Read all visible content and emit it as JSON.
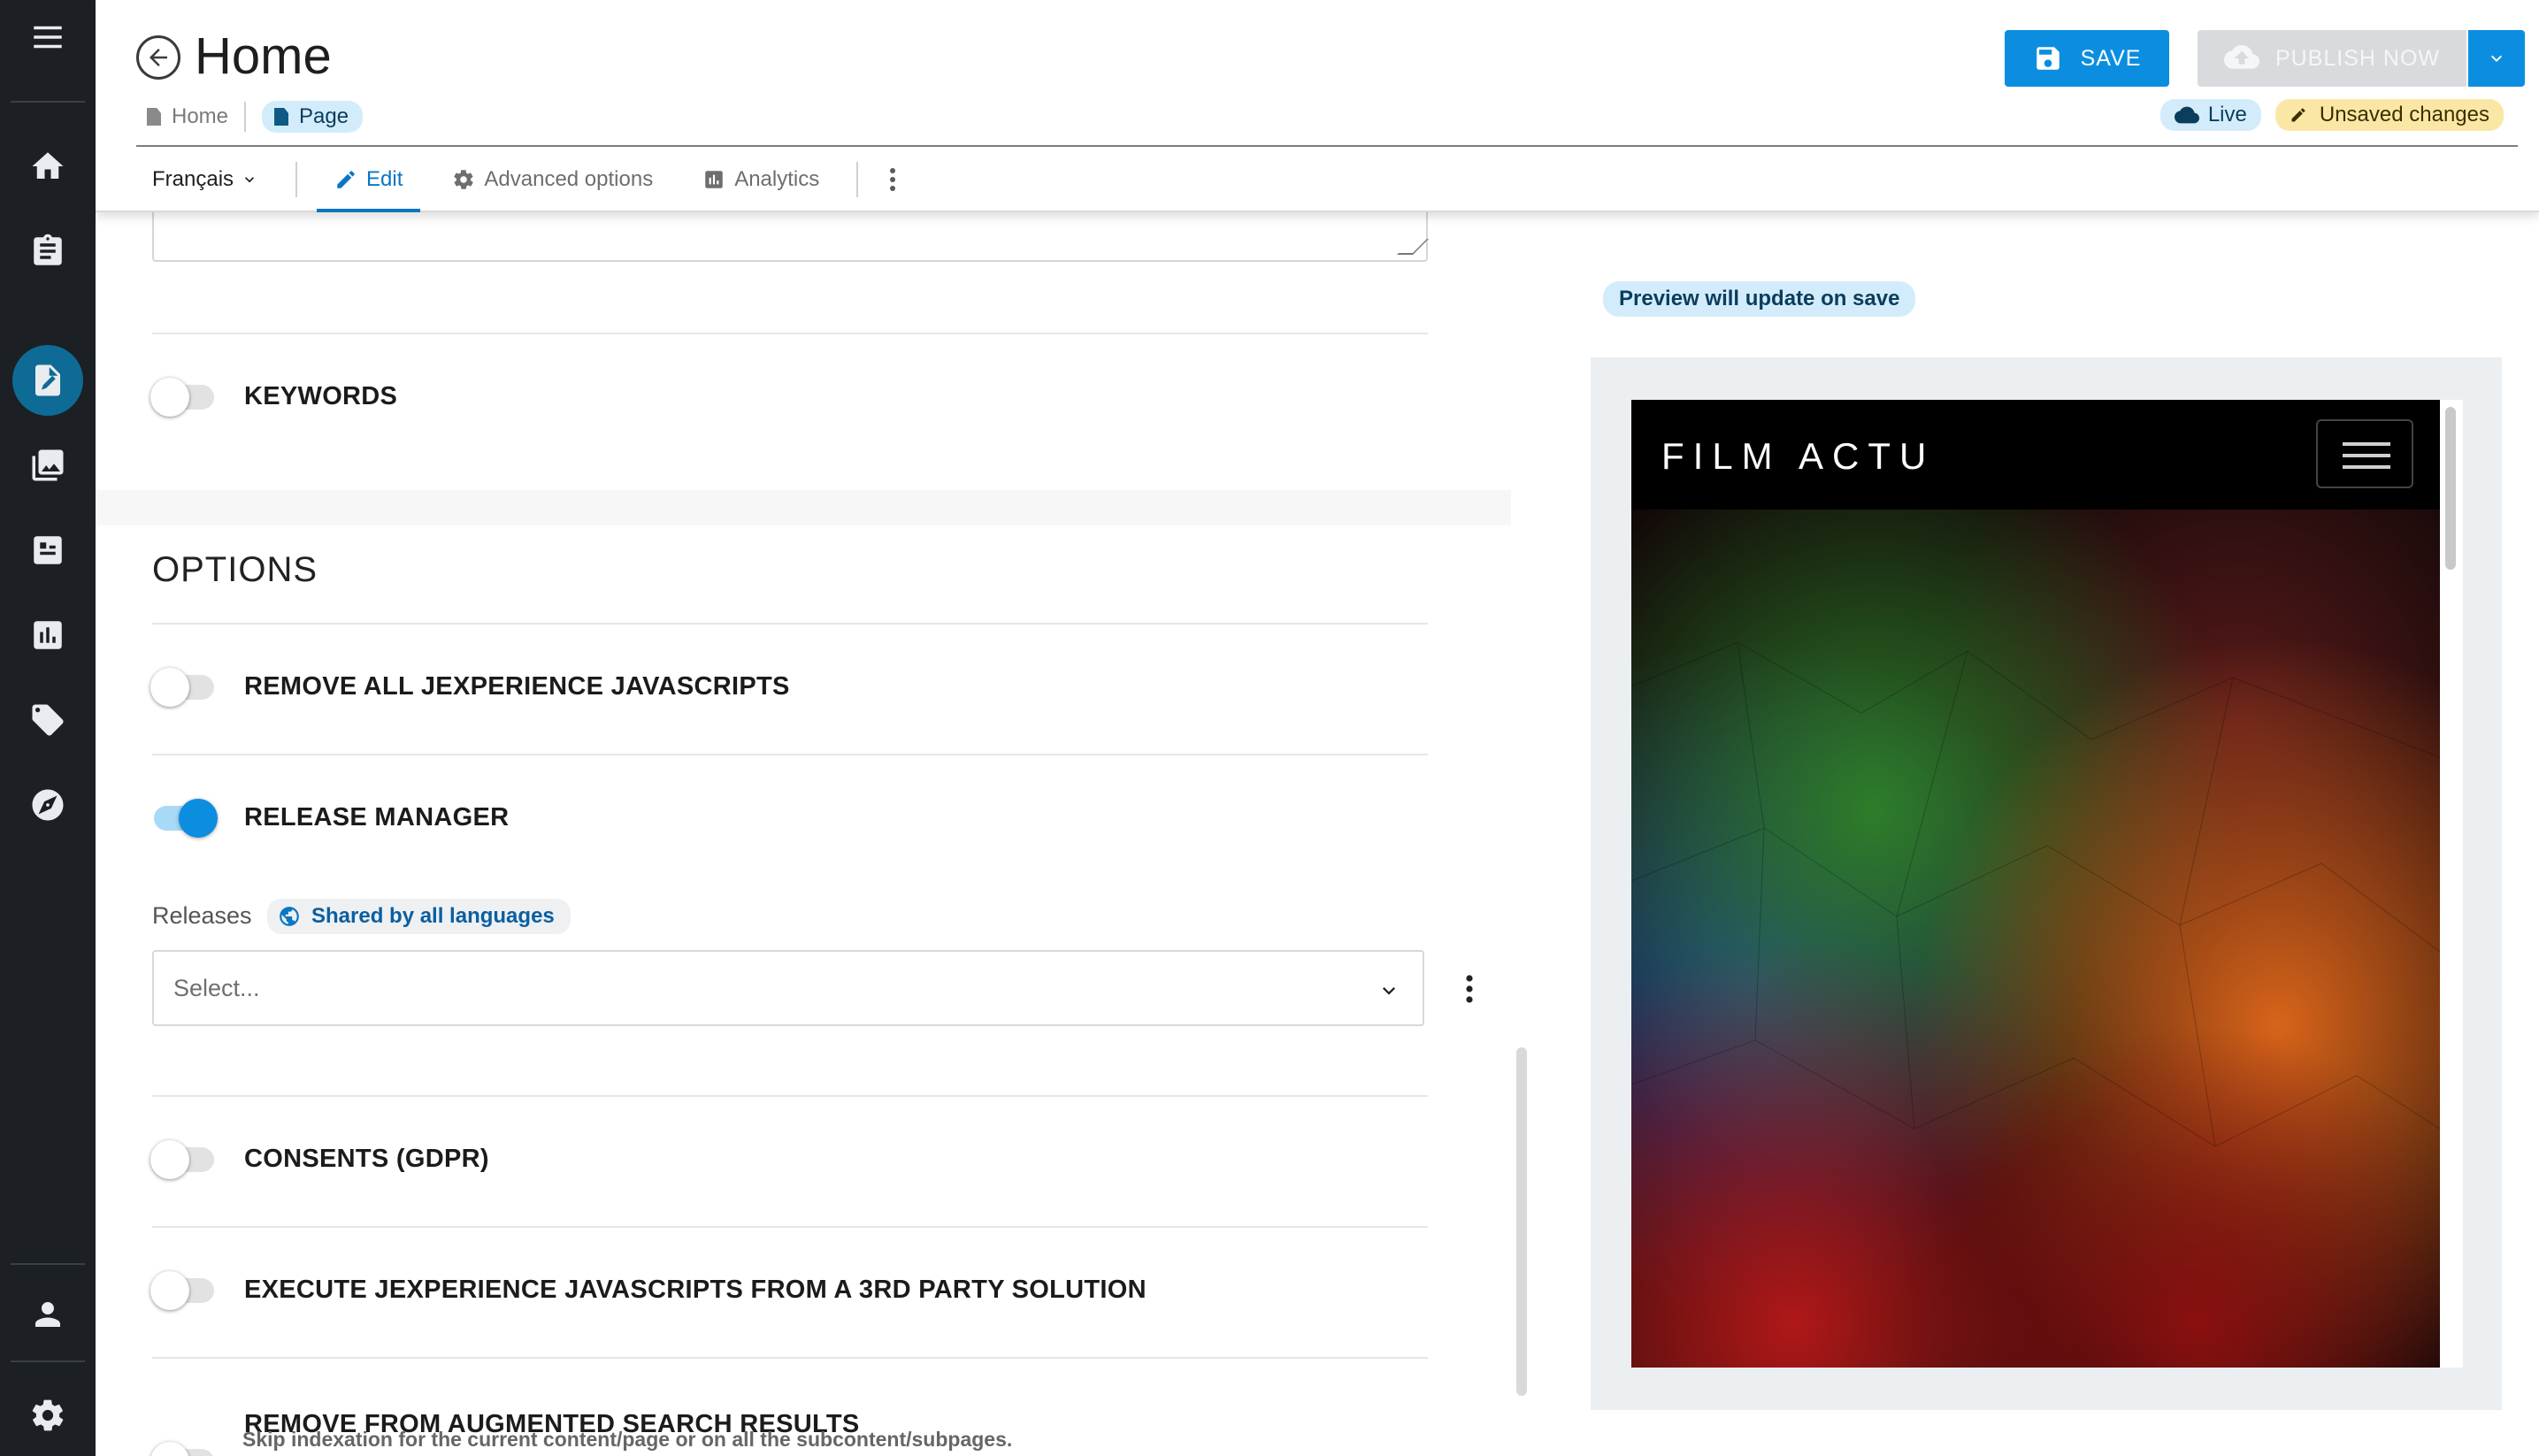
{
  "page": {
    "title": "Home",
    "breadcrumb": {
      "parent": "Home",
      "current": "Page"
    },
    "status": {
      "live": "Live",
      "unsaved": "Unsaved changes"
    }
  },
  "toolbar": {
    "save_label": "SAVE",
    "publish_label": "PUBLISH NOW"
  },
  "tabs": {
    "language": "Français",
    "items": [
      {
        "label": "Edit",
        "icon": "pencil-icon"
      },
      {
        "label": "Advanced options",
        "icon": "gear-icon"
      },
      {
        "label": "Analytics",
        "icon": "bar-chart-icon"
      }
    ]
  },
  "editor": {
    "keywords_label": "KEYWORDS",
    "options_title": "OPTIONS",
    "toggles": [
      {
        "label": "REMOVE ALL JEXPERIENCE JAVASCRIPTS",
        "on": false
      },
      {
        "label": "RELEASE MANAGER",
        "on": true
      },
      {
        "label": "CONSENTS (GDPR)",
        "on": false
      },
      {
        "label": "EXECUTE JEXPERIENCE JAVASCRIPTS FROM A 3RD PARTY SOLUTION",
        "on": false
      },
      {
        "label": "REMOVE FROM AUGMENTED SEARCH RESULTS",
        "on": false
      }
    ],
    "releases": {
      "label": "Releases",
      "shared_badge": "Shared by all languages",
      "placeholder": "Select..."
    },
    "augmented_search_description": "Skip indexation for the current content/page or on all the subcontent/subpages."
  },
  "preview": {
    "notice": "Preview will update on save",
    "site_brand": "FILM ACTU"
  },
  "colors": {
    "sidebar_bg": "#1c1f23",
    "accent": "#0c8ee0",
    "active_tab": "#0b76c4",
    "unsaved_bg": "#fbe7a5",
    "live_bg": "#d3ecfb"
  },
  "sidebar": {
    "icons": [
      "menu-icon",
      "home-icon",
      "clipboard-icon",
      "page-editor-icon",
      "images-icon",
      "content-list-icon",
      "analytics-icon",
      "tag-icon",
      "compass-icon",
      "user-icon",
      "settings-icon"
    ],
    "active": "page-editor-icon"
  }
}
